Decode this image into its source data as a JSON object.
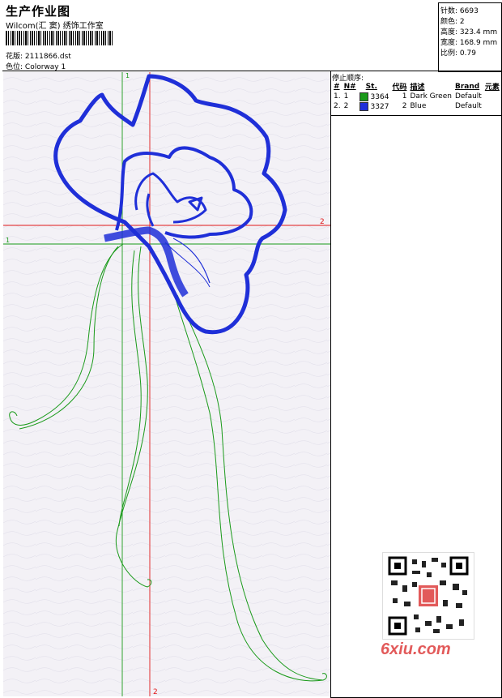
{
  "header": {
    "title": "生产作业图",
    "company": "Wilcom(汇 窦) 绣饰工作室",
    "design_label": "花版:",
    "design_value": "2111866.dst",
    "colorway_label": "色位:",
    "colorway_value": "Colorway 1"
  },
  "stats": [
    {
      "label": "针数:",
      "value": "6693"
    },
    {
      "label": "颜色:",
      "value": "2"
    },
    {
      "label": "高度:",
      "value": "323.4 mm"
    },
    {
      "label": "宽度:",
      "value": "168.9 mm"
    },
    {
      "label": "比例:",
      "value": "0.79"
    }
  ],
  "legend": {
    "heading": "停止顺序:",
    "columns": [
      "#",
      "N#",
      "St.",
      "代码",
      "描述",
      "Brand",
      "元素"
    ],
    "rows": [
      {
        "index": "1.",
        "n": "1",
        "color": "#1a9a1a",
        "st": "3364",
        "code": "1",
        "desc": "Dark Green",
        "brand": "Default"
      },
      {
        "index": "2.",
        "n": "2",
        "color": "#1f2fd8",
        "st": "3327",
        "code": "2",
        "desc": "Blue",
        "brand": "Default"
      }
    ]
  },
  "axes": {
    "v1_label": "1",
    "v2_label": "2",
    "h1_label": "1",
    "h2_label": "2"
  },
  "watermark": "6xiu.com",
  "colors": {
    "green": "#1a9a1a",
    "blue": "#1f2fd8",
    "red": "#e01818"
  }
}
